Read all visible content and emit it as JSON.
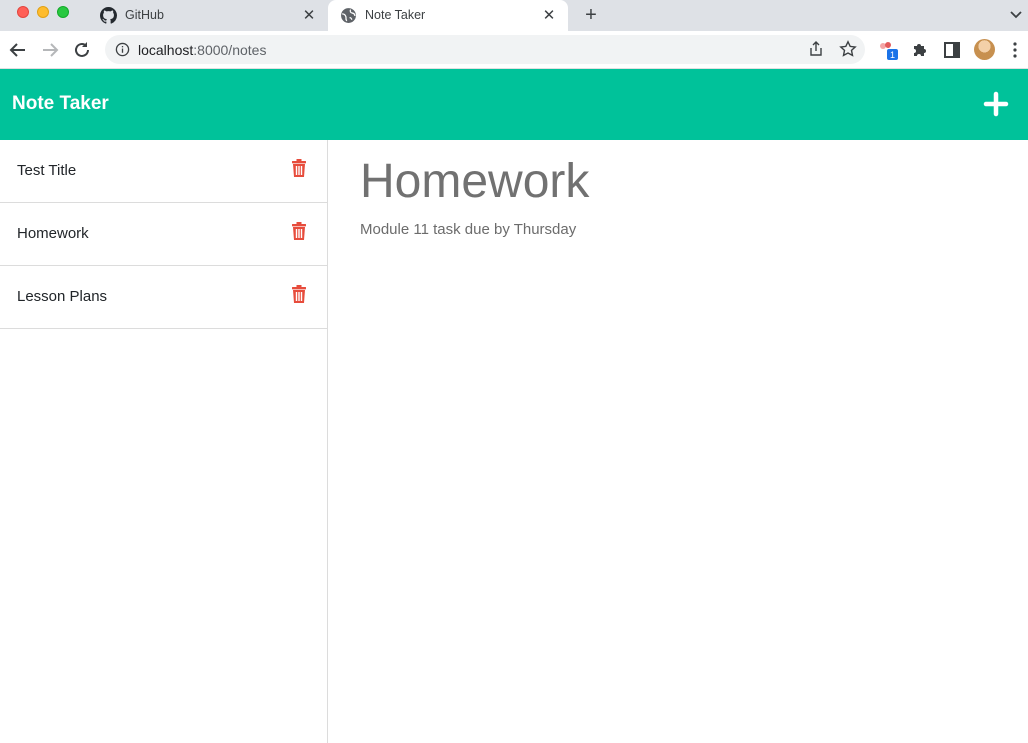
{
  "browser": {
    "tabs": [
      {
        "title": "GitHub",
        "icon": "github-icon"
      },
      {
        "title": "Note Taker",
        "icon": "globe-icon"
      }
    ],
    "url_host": "localhost",
    "url_path": ":8000/notes",
    "extension_badge": "1"
  },
  "app": {
    "brand": "Note Taker",
    "accent_color": "#00c29a",
    "delete_color": "#e74c3c",
    "notes": [
      {
        "title": "Test Title"
      },
      {
        "title": "Homework"
      },
      {
        "title": "Lesson Plans"
      }
    ],
    "active_note": {
      "title": "Homework",
      "text": "Module 11 task due by Thursday"
    }
  }
}
